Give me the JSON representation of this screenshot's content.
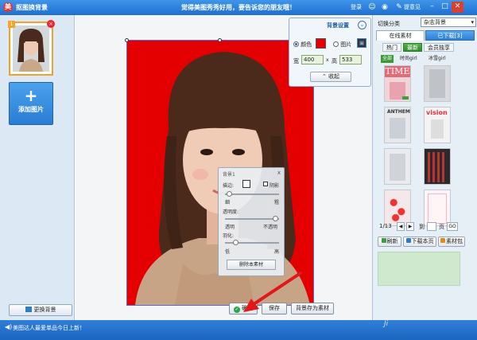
{
  "window": {
    "app_icon": "meitu-logo-icon",
    "title": "抠图换背景",
    "slogan": "觉得美图秀秀好用，要告诉您的朋友哦！",
    "login": "登录",
    "feedback": "提意见",
    "controls": [
      "–",
      "□",
      "✕"
    ]
  },
  "left_panel": {
    "thumb_number": "1",
    "add_image_plus": "+",
    "add_image_label": "添加图片",
    "replace_bg_label": "更换背景"
  },
  "bg_settings": {
    "title": "背景设置",
    "color_label": "颜色",
    "picture_label": "图片",
    "swatch_color": "#e40000",
    "width_label": "宽",
    "width_value": "400",
    "x_label": "x",
    "height_label": "高",
    "height_value": "533",
    "fold_label": "收起"
  },
  "layer_panel": {
    "title": "背景1",
    "close": "x",
    "edge_label": "描边:",
    "shadow_label": "阴影",
    "thin_label": "细",
    "thick_label": "粗",
    "opacity_label": "透明度:",
    "transparent_label": "透明",
    "opaque_label": "不透明",
    "feather_label": "羽化:",
    "low_label": "低",
    "high_label": "高",
    "delete_label": "删除本素材"
  },
  "bottom_buttons": {
    "confirm": "确定",
    "save": "保存",
    "save_as_material": "背景存为素材"
  },
  "right_panel": {
    "switch_label": "切换分类",
    "category_value": "杂志背景",
    "tab_online": "在线素材",
    "tab_downloaded": "已下载[3]",
    "subtabs": [
      "热门",
      "最新",
      "会员独享"
    ],
    "filters": [
      "全部",
      "时尚girl",
      "冰雪girl"
    ],
    "tiles": [
      {
        "caption": "TIME",
        "bg": "#f2d4d8"
      },
      {
        "caption": "",
        "bg": "#d9dadd"
      },
      {
        "caption": "ANTHEM",
        "bg": "#e6e8ec"
      },
      {
        "caption": "vision",
        "bg": "#f3f3f3"
      },
      {
        "caption": "",
        "bg": "#e9ebee"
      },
      {
        "caption": "",
        "bg": "#2a2a2a"
      },
      {
        "caption": "",
        "bg": "#f4e8ea"
      },
      {
        "caption": "",
        "bg": "#fff4f6"
      }
    ],
    "pager_text": "1/13",
    "pager_to": "到",
    "pager_page": "页",
    "pager_go": "GO",
    "refresh": "刷新",
    "download_page": "下载本页",
    "material_pack": "素材包"
  },
  "status_bar": {
    "message": "美图达人最爱单品今日上新！",
    "corner_mark": "Ji"
  }
}
